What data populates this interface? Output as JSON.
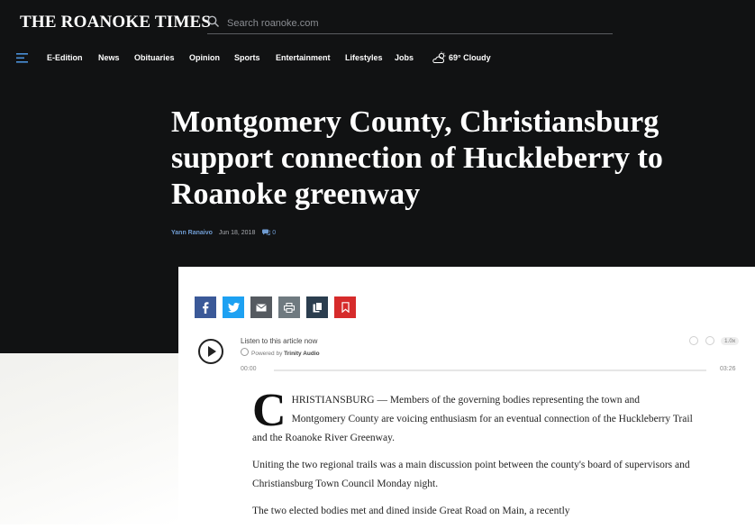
{
  "site": {
    "logo": "THE ROANOKE TIMES",
    "search_placeholder": "Search roanoke.com"
  },
  "nav": {
    "items": [
      "E-Edition",
      "News",
      "Obituaries",
      "Opinion",
      "Sports",
      "Entertainment",
      "Lifestyles",
      "Jobs"
    ],
    "weather": "69° Cloudy"
  },
  "article": {
    "headline": "Montgomery County, Christiansburg support connection of Huckleberry to Roanoke greenway",
    "author": "Yann Ranaivo",
    "date": "Jun 18, 2018",
    "comment_count": "0",
    "dropcap": "C",
    "paragraphs": [
      "HRISTIANSBURG — Members of the governing bodies representing the town and Montgomery County are voicing enthusiasm for an eventual connection of the Huckleberry Trail and the Roanoke River Greenway.",
      "Uniting the two regional trails was a main discussion point between the county's board of supervisors and Christiansburg Town Council Monday night.",
      "The two elected bodies met and dined inside Great Road on Main, a recently"
    ]
  },
  "share": {
    "buttons": [
      "facebook",
      "twitter",
      "email",
      "print",
      "copy",
      "bookmark"
    ],
    "colors": [
      "#3b5998",
      "#1da1f2",
      "#555a60",
      "#6f7a80",
      "#2b3e4f",
      "#d62b2b"
    ]
  },
  "audio": {
    "title": "Listen to this article now",
    "powered_prefix": "Powered by",
    "powered_by": "Trinity Audio",
    "time_start": "00:00",
    "time_end": "03:26",
    "speed": "1.0x",
    "progress": 0
  },
  "colors": {
    "header_bg": "#111213",
    "author_link": "#6f9bd1"
  }
}
